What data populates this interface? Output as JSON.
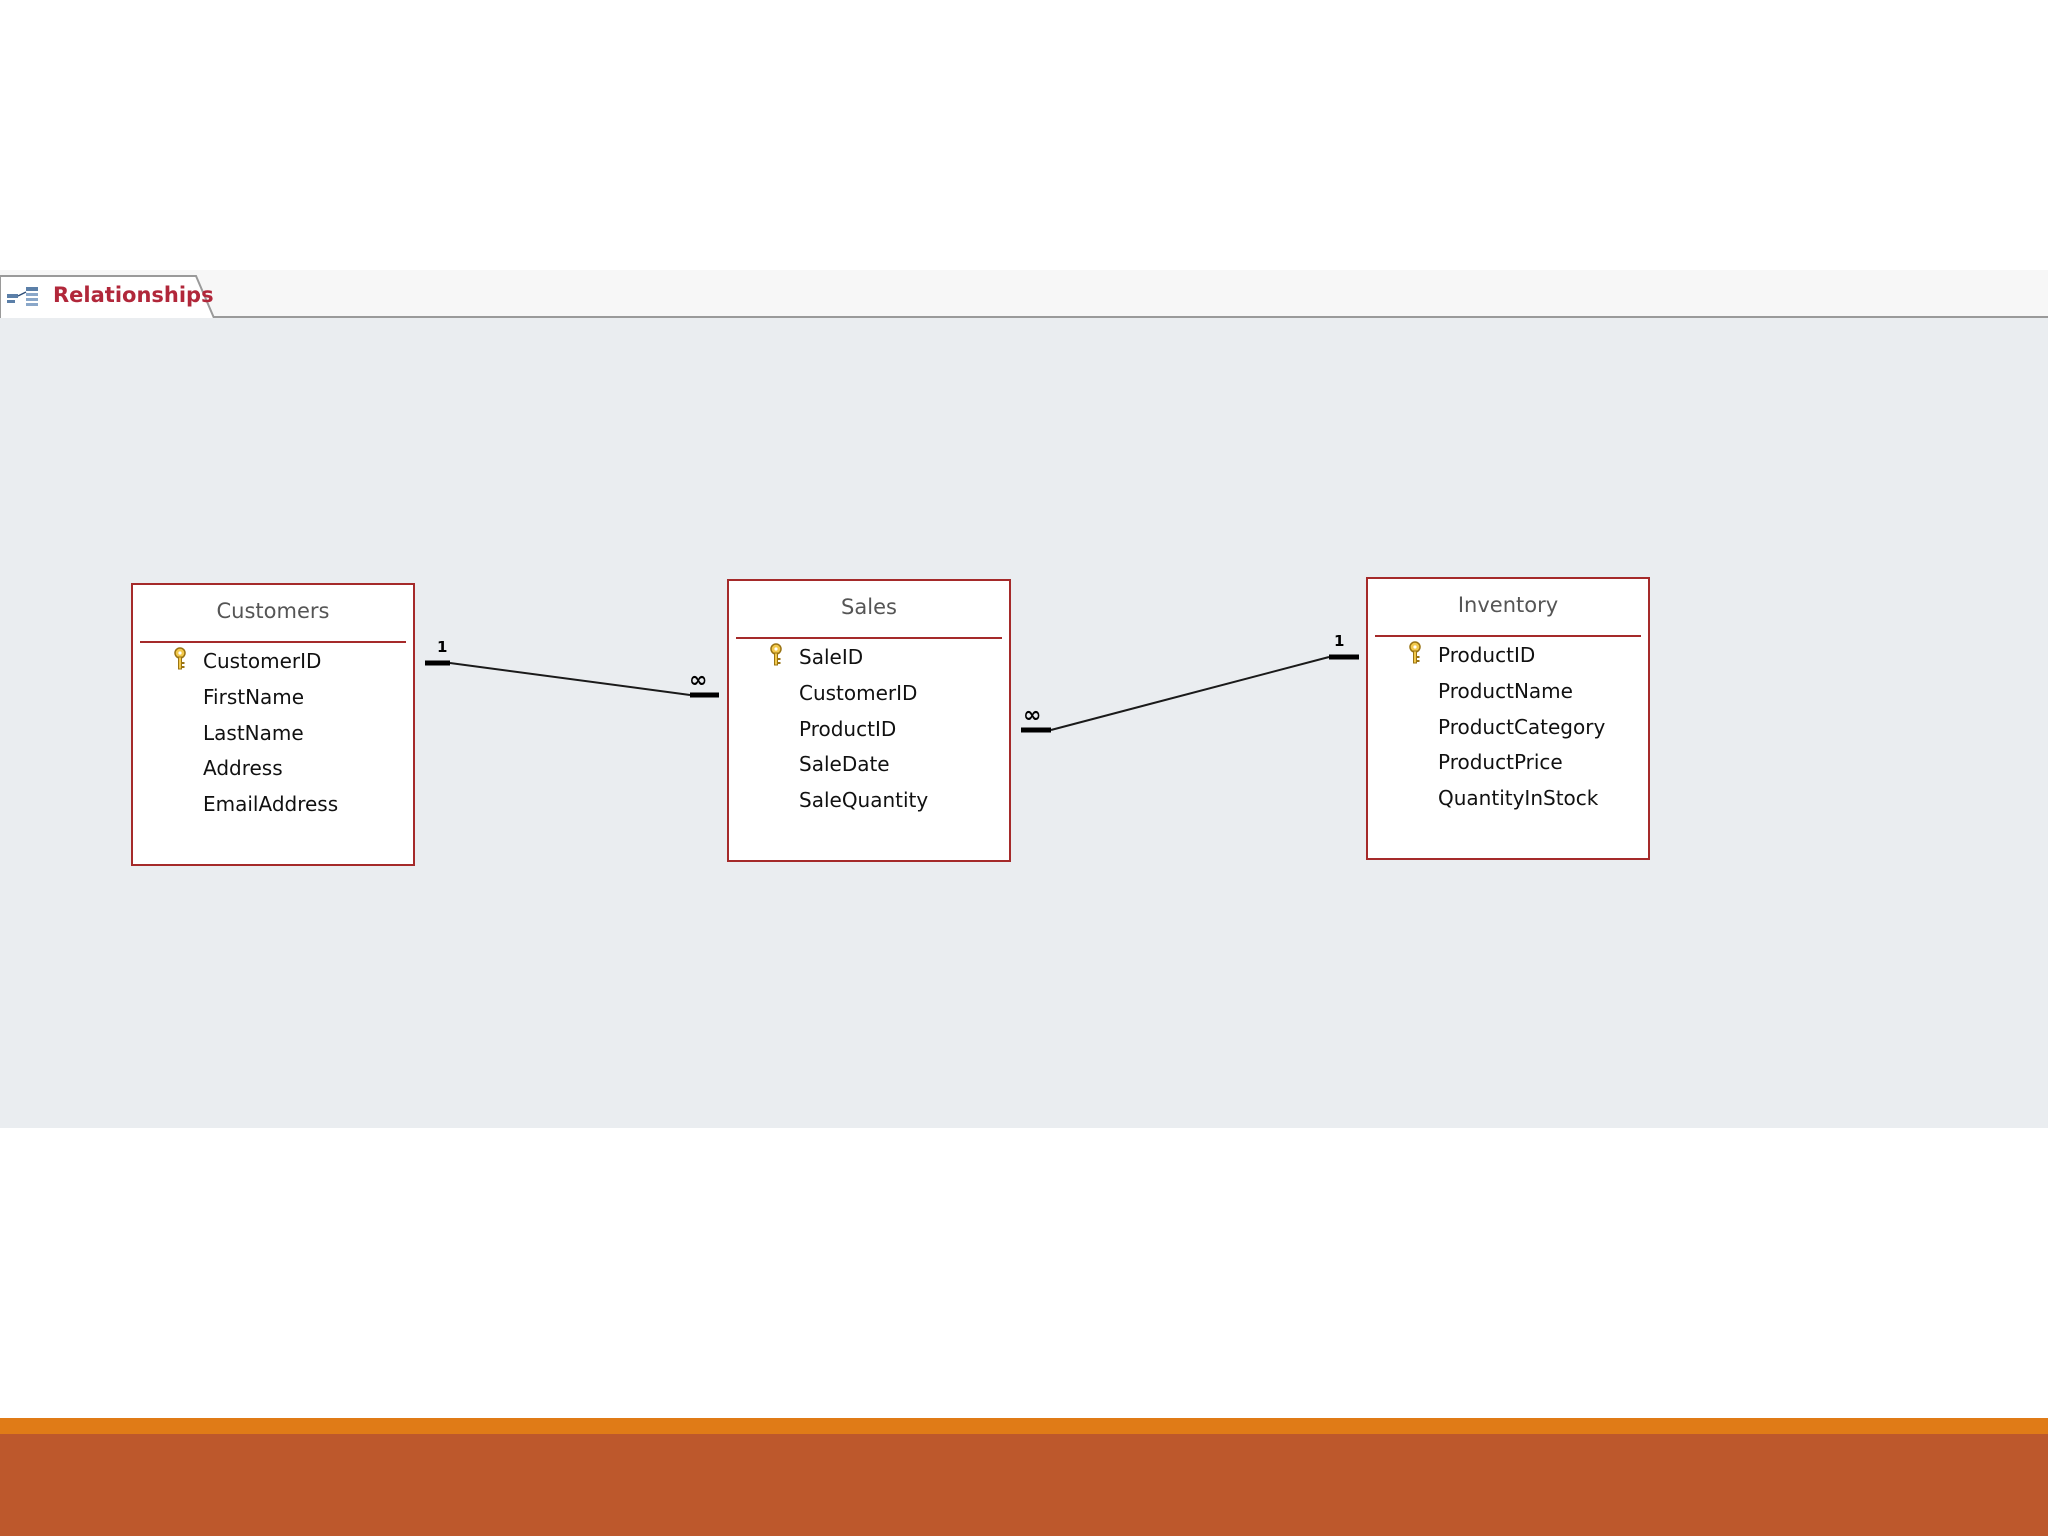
{
  "tab": {
    "label": "Relationships",
    "icon": "relationships-icon"
  },
  "tables": {
    "customers": {
      "title": "Customers",
      "fields": [
        "CustomerID",
        "FirstName",
        "LastName",
        "Address",
        "EmailAddress"
      ],
      "primary_key": "CustomerID"
    },
    "sales": {
      "title": "Sales",
      "fields": [
        "SaleID",
        "CustomerID",
        "ProductID",
        "SaleDate",
        "SaleQuantity"
      ],
      "primary_key": "SaleID"
    },
    "inventory": {
      "title": "Inventory",
      "fields": [
        "ProductID",
        "ProductName",
        "ProductCategory",
        "ProductPrice",
        "QuantityInStock"
      ],
      "primary_key": "ProductID"
    }
  },
  "relationships": [
    {
      "from_table": "Customers",
      "from_field": "CustomerID",
      "from_cardinality": "1",
      "to_table": "Sales",
      "to_field": "CustomerID",
      "to_cardinality": "∞"
    },
    {
      "from_table": "Inventory",
      "from_field": "ProductID",
      "from_cardinality": "1",
      "to_table": "Sales",
      "to_field": "ProductID",
      "to_cardinality": "∞"
    }
  ],
  "colors": {
    "table_border": "#a52a2a",
    "tab_label": "#b1273a",
    "canvas_background": "#eaedf0",
    "footer_orange": "#e07b17",
    "footer_rust": "#bd582c",
    "key_icon": "#d9a521"
  }
}
